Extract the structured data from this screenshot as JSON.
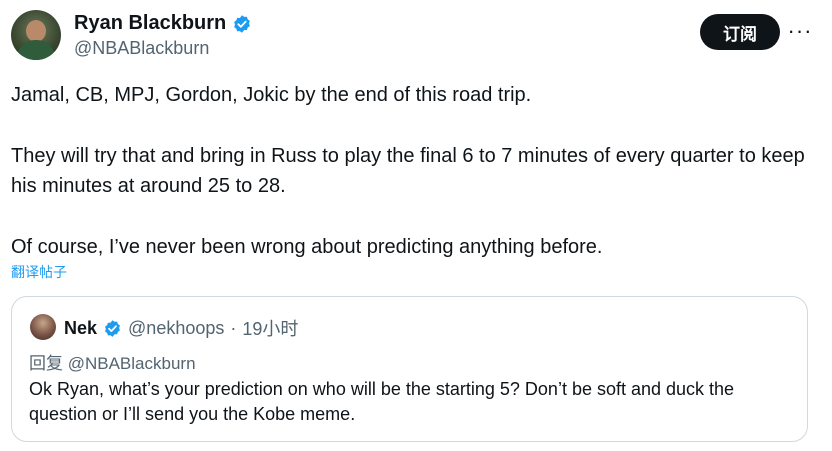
{
  "tweet": {
    "display_name": "Ryan Blackburn",
    "handle": "@NBABlackburn",
    "subscribe_label": "订阅",
    "more_label": "···",
    "paragraphs": [
      "Jamal, CB, MPJ, Gordon, Jokic by the end of this road trip.",
      "They will try that and bring in Russ to play the final 6 to 7 minutes of every quarter to keep his minutes at around 25 to 28.",
      "Of course, I’ve never been wrong about predicting anything before."
    ],
    "translate_label": "翻译帖子"
  },
  "quote": {
    "display_name": "Nek",
    "handle": "@nekhoops",
    "separator": "·",
    "time": "19小时",
    "reply_to": "回复 @NBABlackburn",
    "text": "Ok Ryan, what’s your prediction on who will be the starting 5? Don’t be soft and duck the question or I’ll send you the Kobe meme."
  },
  "colors": {
    "text": "#0f1419",
    "secondary": "#536471",
    "link": "#1d9bf0",
    "verified": "#1d9bf0",
    "border": "#cfd9de"
  }
}
